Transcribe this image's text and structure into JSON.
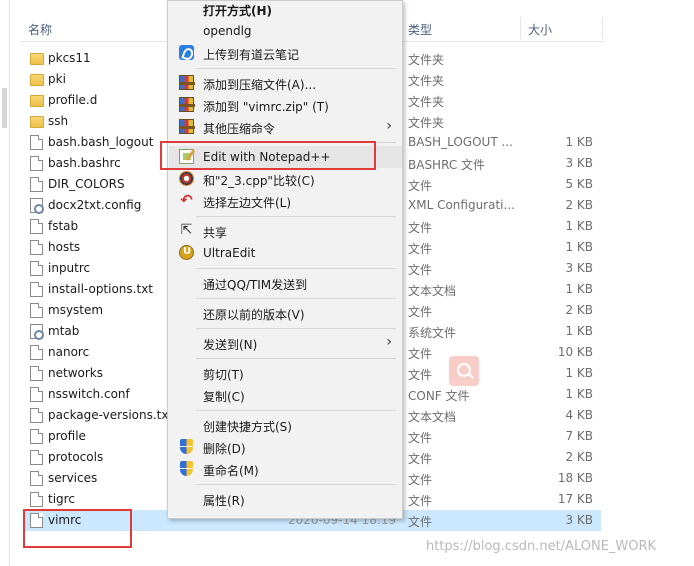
{
  "columns": {
    "name": "名称",
    "type": "类型",
    "size": "大小"
  },
  "files": [
    {
      "name": "pkcs11",
      "icon": "folder",
      "type": "文件夹",
      "size": ""
    },
    {
      "name": "pki",
      "icon": "folder",
      "type": "文件夹",
      "size": ""
    },
    {
      "name": "profile.d",
      "icon": "folder",
      "type": "文件夹",
      "size": ""
    },
    {
      "name": "ssh",
      "icon": "folder",
      "type": "文件夹",
      "size": ""
    },
    {
      "name": "bash.bash_logout",
      "icon": "file",
      "type": "BASH_LOGOUT ...",
      "size": "1 KB"
    },
    {
      "name": "bash.bashrc",
      "icon": "file",
      "type": "BASHRC 文件",
      "size": "3 KB"
    },
    {
      "name": "DIR_COLORS",
      "icon": "file",
      "type": "文件",
      "size": "5 KB"
    },
    {
      "name": "docx2txt.config",
      "icon": "config",
      "type": "XML Configurati...",
      "size": "2 KB"
    },
    {
      "name": "fstab",
      "icon": "file",
      "type": "文件",
      "size": "1 KB"
    },
    {
      "name": "hosts",
      "icon": "file",
      "type": "文件",
      "size": "1 KB"
    },
    {
      "name": "inputrc",
      "icon": "file",
      "type": "文件",
      "size": "3 KB"
    },
    {
      "name": "install-options.txt",
      "icon": "file",
      "type": "文本文档",
      "size": "1 KB"
    },
    {
      "name": "msystem",
      "icon": "file",
      "type": "文件",
      "size": "2 KB"
    },
    {
      "name": "mtab",
      "icon": "config",
      "type": "系统文件",
      "size": "1 KB"
    },
    {
      "name": "nanorc",
      "icon": "file",
      "type": "文件",
      "size": "10 KB"
    },
    {
      "name": "networks",
      "icon": "file",
      "type": "文件",
      "size": "1 KB"
    },
    {
      "name": "nsswitch.conf",
      "icon": "file",
      "type": "CONF 文件",
      "size": "1 KB"
    },
    {
      "name": "package-versions.txt",
      "icon": "file",
      "type": "文本文档",
      "size": "4 KB"
    },
    {
      "name": "profile",
      "icon": "file",
      "type": "文件",
      "size": "7 KB"
    },
    {
      "name": "protocols",
      "icon": "file",
      "type": "文件",
      "size": "2 KB"
    },
    {
      "name": "services",
      "icon": "file",
      "type": "文件",
      "size": "18 KB"
    },
    {
      "name": "tigrc",
      "icon": "file",
      "type": "文件",
      "size": "17 KB"
    },
    {
      "name": "vimrc",
      "icon": "file",
      "type": "文件",
      "size": "3 KB",
      "date": "2020-09-14 18:19",
      "selected": true
    }
  ],
  "context_menu": {
    "items": [
      {
        "label": "打开方式(H)",
        "bold": true
      },
      {
        "label": "opendlg"
      },
      {
        "label": "上传到有道云笔记",
        "icon": "youdao-note-icon"
      },
      {
        "sep": true
      },
      {
        "label": "添加到压缩文件(A)...",
        "icon": "winrar-icon"
      },
      {
        "label": "添加到 \"vimrc.zip\" (T)",
        "icon": "winrar-icon"
      },
      {
        "label": "其他压缩命令",
        "icon": "winrar-icon",
        "submenu": true
      },
      {
        "sep": true
      },
      {
        "label": "Edit with Notepad++",
        "icon": "notepad-plus-plus-icon",
        "highlighted": true
      },
      {
        "label": "和\"2_3.cpp\"比较(C)",
        "icon": "beyond-compare-icon"
      },
      {
        "label": "选择左边文件(L)",
        "icon": "undo-icon"
      },
      {
        "sep": true
      },
      {
        "label": "共享",
        "icon": "share-icon"
      },
      {
        "label": "UltraEdit",
        "icon": "ultraedit-icon"
      },
      {
        "sep": true
      },
      {
        "label": "通过QQ/TIM发送到"
      },
      {
        "sep": true
      },
      {
        "label": "还原以前的版本(V)"
      },
      {
        "sep": true
      },
      {
        "label": "发送到(N)",
        "submenu": true
      },
      {
        "sep": true
      },
      {
        "label": "剪切(T)"
      },
      {
        "label": "复制(C)"
      },
      {
        "sep": true
      },
      {
        "label": "创建快捷方式(S)"
      },
      {
        "label": "删除(D)",
        "icon": "shield-icon"
      },
      {
        "label": "重命名(M)",
        "icon": "shield-icon"
      },
      {
        "sep": true
      },
      {
        "label": "属性(R)"
      }
    ]
  },
  "watermark": "https://blog.csdn.net/ALONE_WORK",
  "colors": {
    "selection": "#cce8ff",
    "annotation_red": "#e03b3b",
    "menu_bg": "#f2f2f2"
  }
}
